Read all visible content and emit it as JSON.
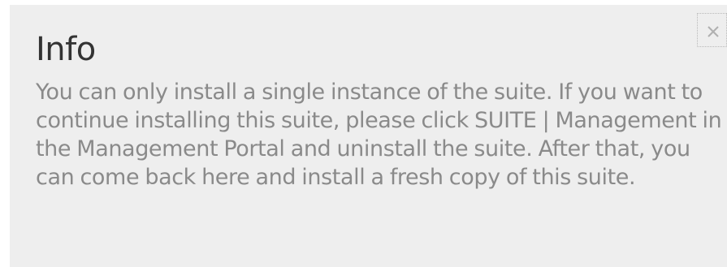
{
  "dialog": {
    "title": "Info",
    "message": "You can only install a single instance of the suite. If you want to continue installing this suite, please click SUITE | Management in the Management Portal and uninstall the suite. After that, you can come back here and install a fresh copy of this suite.",
    "close_icon": "close-icon"
  },
  "colors": {
    "dialog_background": "#eeeeee",
    "title_text": "#333333",
    "message_text": "#8a8a8a",
    "close_icon": "#b0b0b0"
  }
}
